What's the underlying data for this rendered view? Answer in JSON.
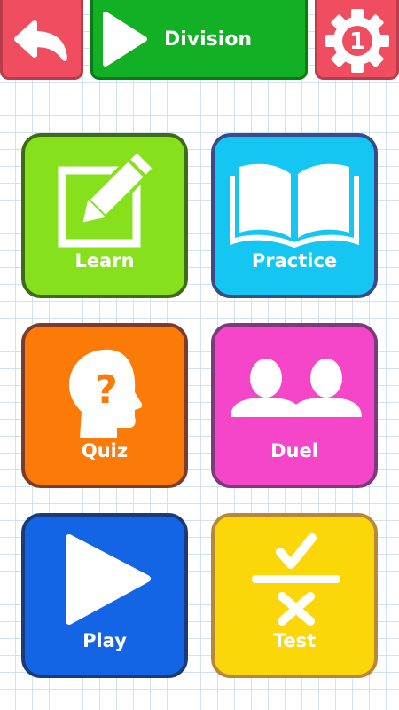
{
  "header": {
    "back_icon": "back-arrow-icon",
    "play_icon": "play-icon",
    "title": "Division",
    "settings_icon": "gear-icon",
    "settings_badge": "1"
  },
  "menu": {
    "learn": {
      "label": "Learn",
      "icon": "edit-icon",
      "color": "#86e01c"
    },
    "practice": {
      "label": "Practice",
      "icon": "book-icon",
      "color": "#15c6f3"
    },
    "quiz": {
      "label": "Quiz",
      "icon": "question-head-icon",
      "color": "#fb7a08"
    },
    "duel": {
      "label": "Duel",
      "icon": "two-people-icon",
      "color": "#f545c9"
    },
    "play": {
      "label": "Play",
      "icon": "play-icon",
      "color": "#1464e6"
    },
    "test": {
      "label": "Test",
      "icon": "check-cross-icon",
      "color": "#fbd70a"
    }
  }
}
